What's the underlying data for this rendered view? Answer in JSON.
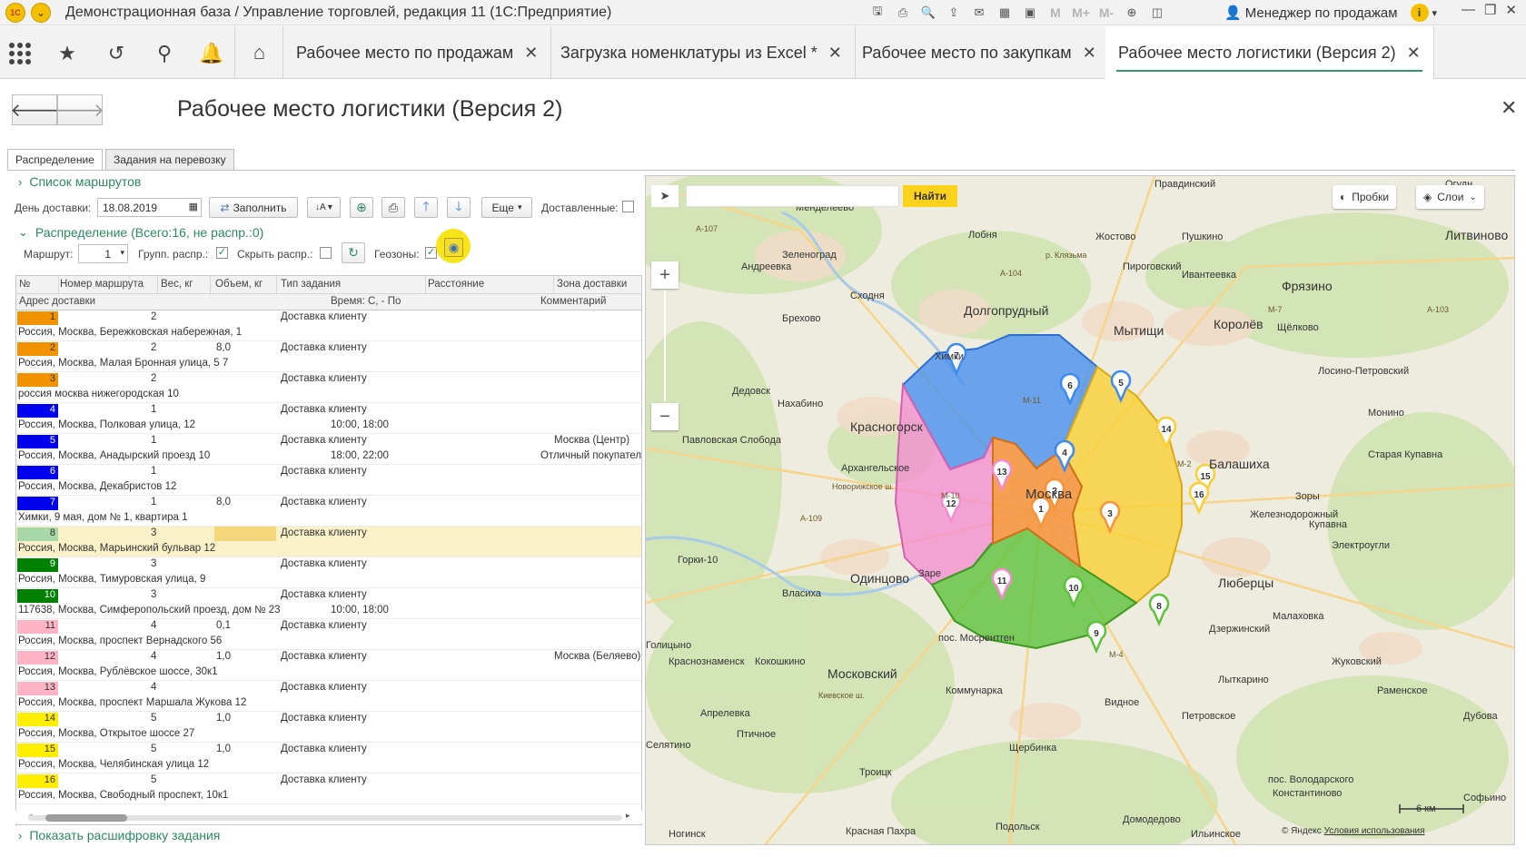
{
  "app": {
    "title": "Демонстрационная база / Управление торговлей, редакция 11  (1С:Предприятие)",
    "user": "Менеджер по продажам",
    "m_buttons": [
      "M",
      "M+",
      "M-"
    ]
  },
  "tabs": [
    {
      "label": "Рабочее место по продажам"
    },
    {
      "label": "Загрузка номенклатуры из Excel *"
    },
    {
      "label": "Рабочее место по закупкам"
    },
    {
      "label": "Рабочее место логистики (Версия 2)"
    }
  ],
  "form": {
    "title": "Рабочее место логистики (Версия 2)",
    "tabs": [
      "Распределение",
      "Задания на перевозку"
    ],
    "routes_list": "Список маршрутов",
    "delivery_day_label": "День доставки:",
    "delivery_day_value": "18.08.2019",
    "fill_label": "Заполнить",
    "more_label": "Еще",
    "delivered_label": "Доставленные:",
    "distribution_header": "Распределение (Всего:16, не распр.:0)",
    "route_label": "Маршрут:",
    "route_value": "1",
    "group_label": "Групп. распр.:",
    "hide_label": "Скрыть распр.:",
    "geozones_label": "Геозоны:",
    "show_decode": "Показать расшифровку задания"
  },
  "table": {
    "columns1": [
      "№",
      "Номер маршрута",
      "Вес, кг",
      "Объем, кг",
      "Тип задания",
      "Расстояние",
      "Зона доставки"
    ],
    "columns2": [
      "Адрес доставки",
      "Время: С, - По",
      "Комментарий"
    ],
    "rows": [
      {
        "num": "1",
        "color": "#f39200",
        "route": "2",
        "weight": "",
        "type": "Доставка клиенту",
        "time": "",
        "zone": "",
        "comment": "",
        "address": "Россия, Москва, Бережковская набережная, 1"
      },
      {
        "num": "2",
        "color": "#f39200",
        "route": "2",
        "weight": "8,0",
        "type": "Доставка клиенту",
        "time": "",
        "zone": "",
        "comment": "",
        "address": "Россия, Москва, Малая Бронная улица, 5 7"
      },
      {
        "num": "3",
        "color": "#f39200",
        "route": "2",
        "weight": "",
        "type": "Доставка клиенту",
        "time": "",
        "zone": "",
        "comment": "",
        "address": "россия москва нижегородская 10"
      },
      {
        "num": "4",
        "color": "#0000ee",
        "route": "1",
        "weight": "",
        "type": "Доставка клиенту",
        "time": "10:00, 18:00",
        "zone": "",
        "comment": "",
        "address": "Россия, Москва, Полковая улица, 12"
      },
      {
        "num": "5",
        "color": "#0000ee",
        "route": "1",
        "weight": "",
        "type": "Доставка клиенту",
        "time": "18:00, 22:00",
        "zone": "Москва (Центр)",
        "comment": "Отличный покупатель",
        "address": "Россия, Москва, Анадырский проезд 10"
      },
      {
        "num": "6",
        "color": "#0000ee",
        "route": "1",
        "weight": "",
        "type": "Доставка клиенту",
        "time": "",
        "zone": "",
        "comment": "",
        "address": "Россия, Москва, Декабристов 12"
      },
      {
        "num": "7",
        "color": "#0000ee",
        "route": "1",
        "weight": "8,0",
        "type": "Доставка клиенту",
        "time": "",
        "zone": "",
        "comment": "",
        "address": "Химки, 9 мая, дом № 1, квартира 1"
      },
      {
        "num": "8",
        "color": "#a8d8a8",
        "route": "3",
        "weight": "",
        "type": "Доставка клиенту",
        "time": "",
        "zone": "",
        "comment": "",
        "address": "Россия, Москва, Марьинский бульвар 12",
        "selected": true
      },
      {
        "num": "9",
        "color": "#008000",
        "route": "3",
        "weight": "",
        "type": "Доставка клиенту",
        "time": "",
        "zone": "",
        "comment": "",
        "address": "Россия, Москва, Тимуровская улица, 9"
      },
      {
        "num": "10",
        "color": "#008000",
        "route": "3",
        "weight": "",
        "type": "Доставка клиенту",
        "time": "10:00, 18:00",
        "zone": "",
        "comment": "",
        "address": "117638, Москва, Симферопольский проезд, дом № 23"
      },
      {
        "num": "11",
        "color": "#ffb3c6",
        "route": "4",
        "weight": "0,1",
        "type": "Доставка клиенту",
        "time": "",
        "zone": "",
        "comment": "",
        "address": "Россия, Москва, проспект Вернадского 56"
      },
      {
        "num": "12",
        "color": "#ffb3c6",
        "route": "4",
        "weight": "1,0",
        "type": "Доставка клиенту",
        "time": "",
        "zone": "Москва (Беляево)",
        "comment": "",
        "address": "Россия, Москва, Рублёвское шоссе, 30к1"
      },
      {
        "num": "13",
        "color": "#ffb3c6",
        "route": "4",
        "weight": "",
        "type": "Доставка клиенту",
        "time": "",
        "zone": "",
        "comment": "",
        "address": "Россия, Москва, проспект Маршала Жукова 12"
      },
      {
        "num": "14",
        "color": "#ffee00",
        "route": "5",
        "weight": "1,0",
        "type": "Доставка клиенту",
        "time": "",
        "zone": "",
        "comment": "",
        "address": "Россия, Москва, Открытое шоссе 27"
      },
      {
        "num": "15",
        "color": "#ffee00",
        "route": "5",
        "weight": "1,0",
        "type": "Доставка клиенту",
        "time": "",
        "zone": "",
        "comment": "",
        "address": "Россия, Москва, Челябинская улица 12"
      },
      {
        "num": "16",
        "color": "#ffee00",
        "route": "5",
        "weight": "",
        "type": "Доставка клиенту",
        "time": "",
        "zone": "",
        "comment": "",
        "address": "Россия, Москва, Свободный проспект, 10к1"
      }
    ]
  },
  "map": {
    "find_label": "Найти",
    "traffic_label": "Пробки",
    "layers_label": "Слои",
    "scale_label": "6 км",
    "copyright": "© Яндекс",
    "terms": "Условия использования",
    "places": [
      "Правдинский",
      "Огудн",
      "Менделеево",
      "Лобня",
      "Жостово",
      "Пушкино",
      "Литвиново",
      "Зеленоград",
      "Андреевка",
      "Пироговский",
      "Ивантеевка",
      "Фрязино",
      "Сходня",
      "Долгопрудный",
      "Мытищи",
      "Королёв",
      "Щёлково",
      "Брехово",
      "Химки",
      "Лосино-Петровский",
      "Дедовск",
      "Нахабино",
      "Монино",
      "Красногорск",
      "Павловская Слобода",
      "Балашиха",
      "Старая Купавна",
      "Архангельское",
      "Москва",
      "Зоры",
      "Железнодорожный",
      "Купавна",
      "Электроугли",
      "Горки-10",
      "Одинцово",
      "Заре",
      "Власиха",
      "Люберцы",
      "Малаховка",
      "Голицыно",
      "пос. Мосрентген",
      "Дзержинский",
      "Краснознаменск",
      "Кокошкино",
      "Московский",
      "Жуковский",
      "Коммунарка",
      "Лыткарино",
      "Раменское",
      "Апрелевка",
      "Видное",
      "Петровское",
      "Дубова",
      "Птичное",
      "Селятино",
      "Щербинка",
      "Троицк",
      "пос. Володарского",
      "Константиново",
      "Софьино",
      "Домодедово",
      "Подольск",
      "Красная Пахра",
      "Ильинское",
      "Ногинск"
    ],
    "roads": [
      "А-107",
      "А-104",
      "М-10",
      "Новорижское ш.",
      "М-11",
      "А-103",
      "М-7",
      "А-109",
      "М-2",
      "М-4",
      "Киевское ш.",
      "р. Клязьма"
    ],
    "markers": [
      "1",
      "2",
      "3",
      "4",
      "5",
      "6",
      "7",
      "8",
      "9",
      "10",
      "11",
      "12",
      "13",
      "14",
      "15",
      "16"
    ],
    "zone_colors": {
      "blue": "#3d8bf0",
      "pink": "#f38bd0",
      "orange": "#f5923a",
      "yellow": "#f9cf35",
      "green": "#5cc23b"
    }
  }
}
